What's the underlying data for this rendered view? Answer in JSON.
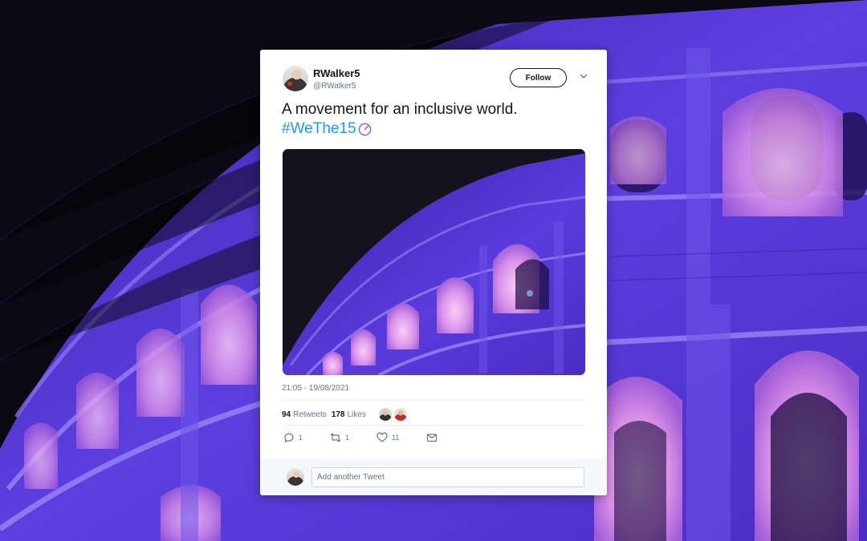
{
  "colors": {
    "page_background": "#0b0a14",
    "accent_hashtag": "#1d9bf0",
    "stone_purple": "#5b3bd6",
    "arch_glow_pink": "#e9a6f2",
    "text_primary": "#14171a",
    "text_secondary": "#657786"
  },
  "tweet": {
    "author": {
      "name": "RWalker5",
      "handle": "@RWalker5",
      "avatar_icon": "avatar-photo"
    },
    "follow_label": "Follow",
    "more_icon": "chevron-down-icon",
    "text": "A movement for an inclusive world.",
    "hashtag": "#WeThe15",
    "hashtag_icon": "wethe15-emblem-icon",
    "media_description_icon": "photo",
    "timestamp": "21:05 - 19/08/2021",
    "stats": {
      "retweets_count": "94",
      "retweets_label": "Retweets",
      "likes_count": "178",
      "likes_label": "Likes"
    },
    "actions": {
      "replies": "1",
      "retweets": "1",
      "likes": "11"
    }
  },
  "reply": {
    "placeholder": "Add another Tweet"
  }
}
